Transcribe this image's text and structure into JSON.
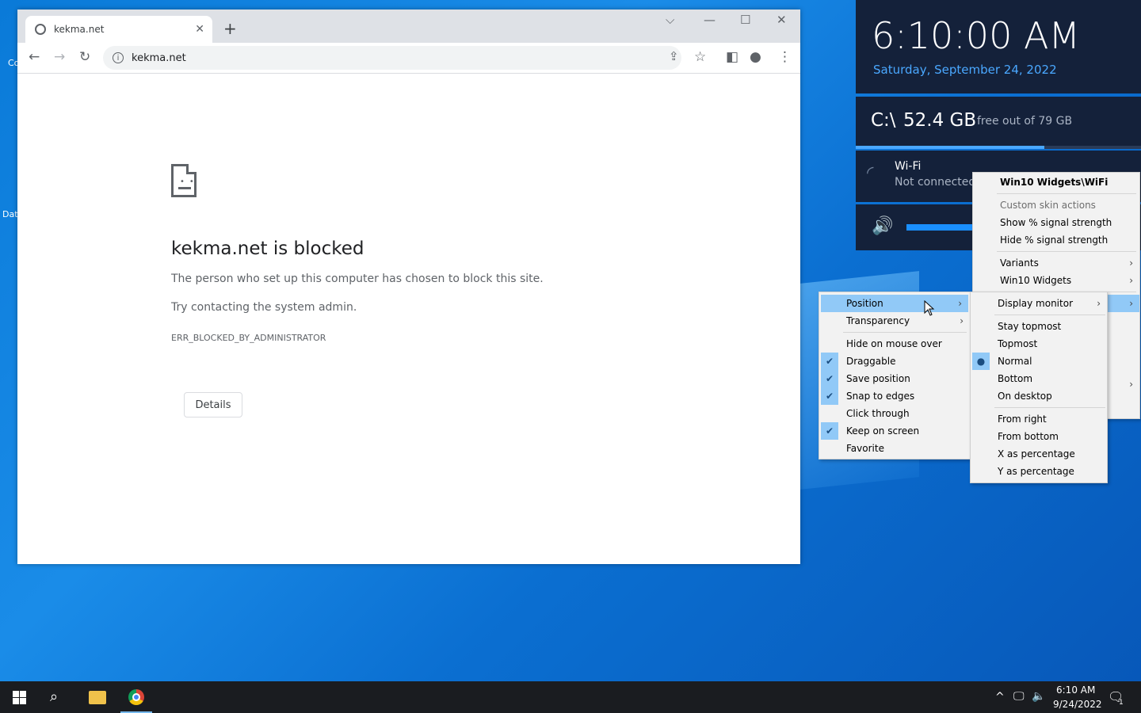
{
  "desktop": {
    "icon_labels": [
      "Co",
      "Dat"
    ]
  },
  "browser": {
    "tab_title": "kekma.net",
    "url": "kekma.net",
    "heading": "kekma.net is blocked",
    "line1": "The person who set up this computer has chosen to block this site.",
    "line2": "Try contacting the system admin.",
    "error_code": "ERR_BLOCKED_BY_ADMINISTRATOR",
    "details_label": "Details"
  },
  "widgets": {
    "time": "6:10:00 AM",
    "date": "Saturday, September 24, 2022",
    "drive_label": "C:\\",
    "drive_free": "52.4 GB",
    "drive_total": "free out of 79 GB",
    "drive_free_fraction": 0.66,
    "wifi_name": "Wi-Fi",
    "wifi_status": "Not connected",
    "volume_fraction": 0.3
  },
  "context_menu": {
    "title": "Win10 Widgets\\WiFi",
    "custom_header": "Custom skin actions",
    "show_signal": "Show % signal strength",
    "hide_signal": "Hide % signal strength",
    "variants": "Variants",
    "win10widgets": "Win10 Widgets"
  },
  "settings_menu": {
    "items": [
      "Position",
      "Transparency",
      "Hide on mouse over",
      "Draggable",
      "Save position",
      "Snap to edges",
      "Click through",
      "Keep on screen",
      "Favorite"
    ]
  },
  "position_menu": {
    "items": [
      "Display monitor",
      "Stay topmost",
      "Topmost",
      "Normal",
      "Bottom",
      "On desktop",
      "From right",
      "From bottom",
      "X as percentage",
      "Y as percentage"
    ]
  },
  "taskbar": {
    "time": "6:10 AM",
    "date": "9/24/2022",
    "notif_count": "1"
  }
}
